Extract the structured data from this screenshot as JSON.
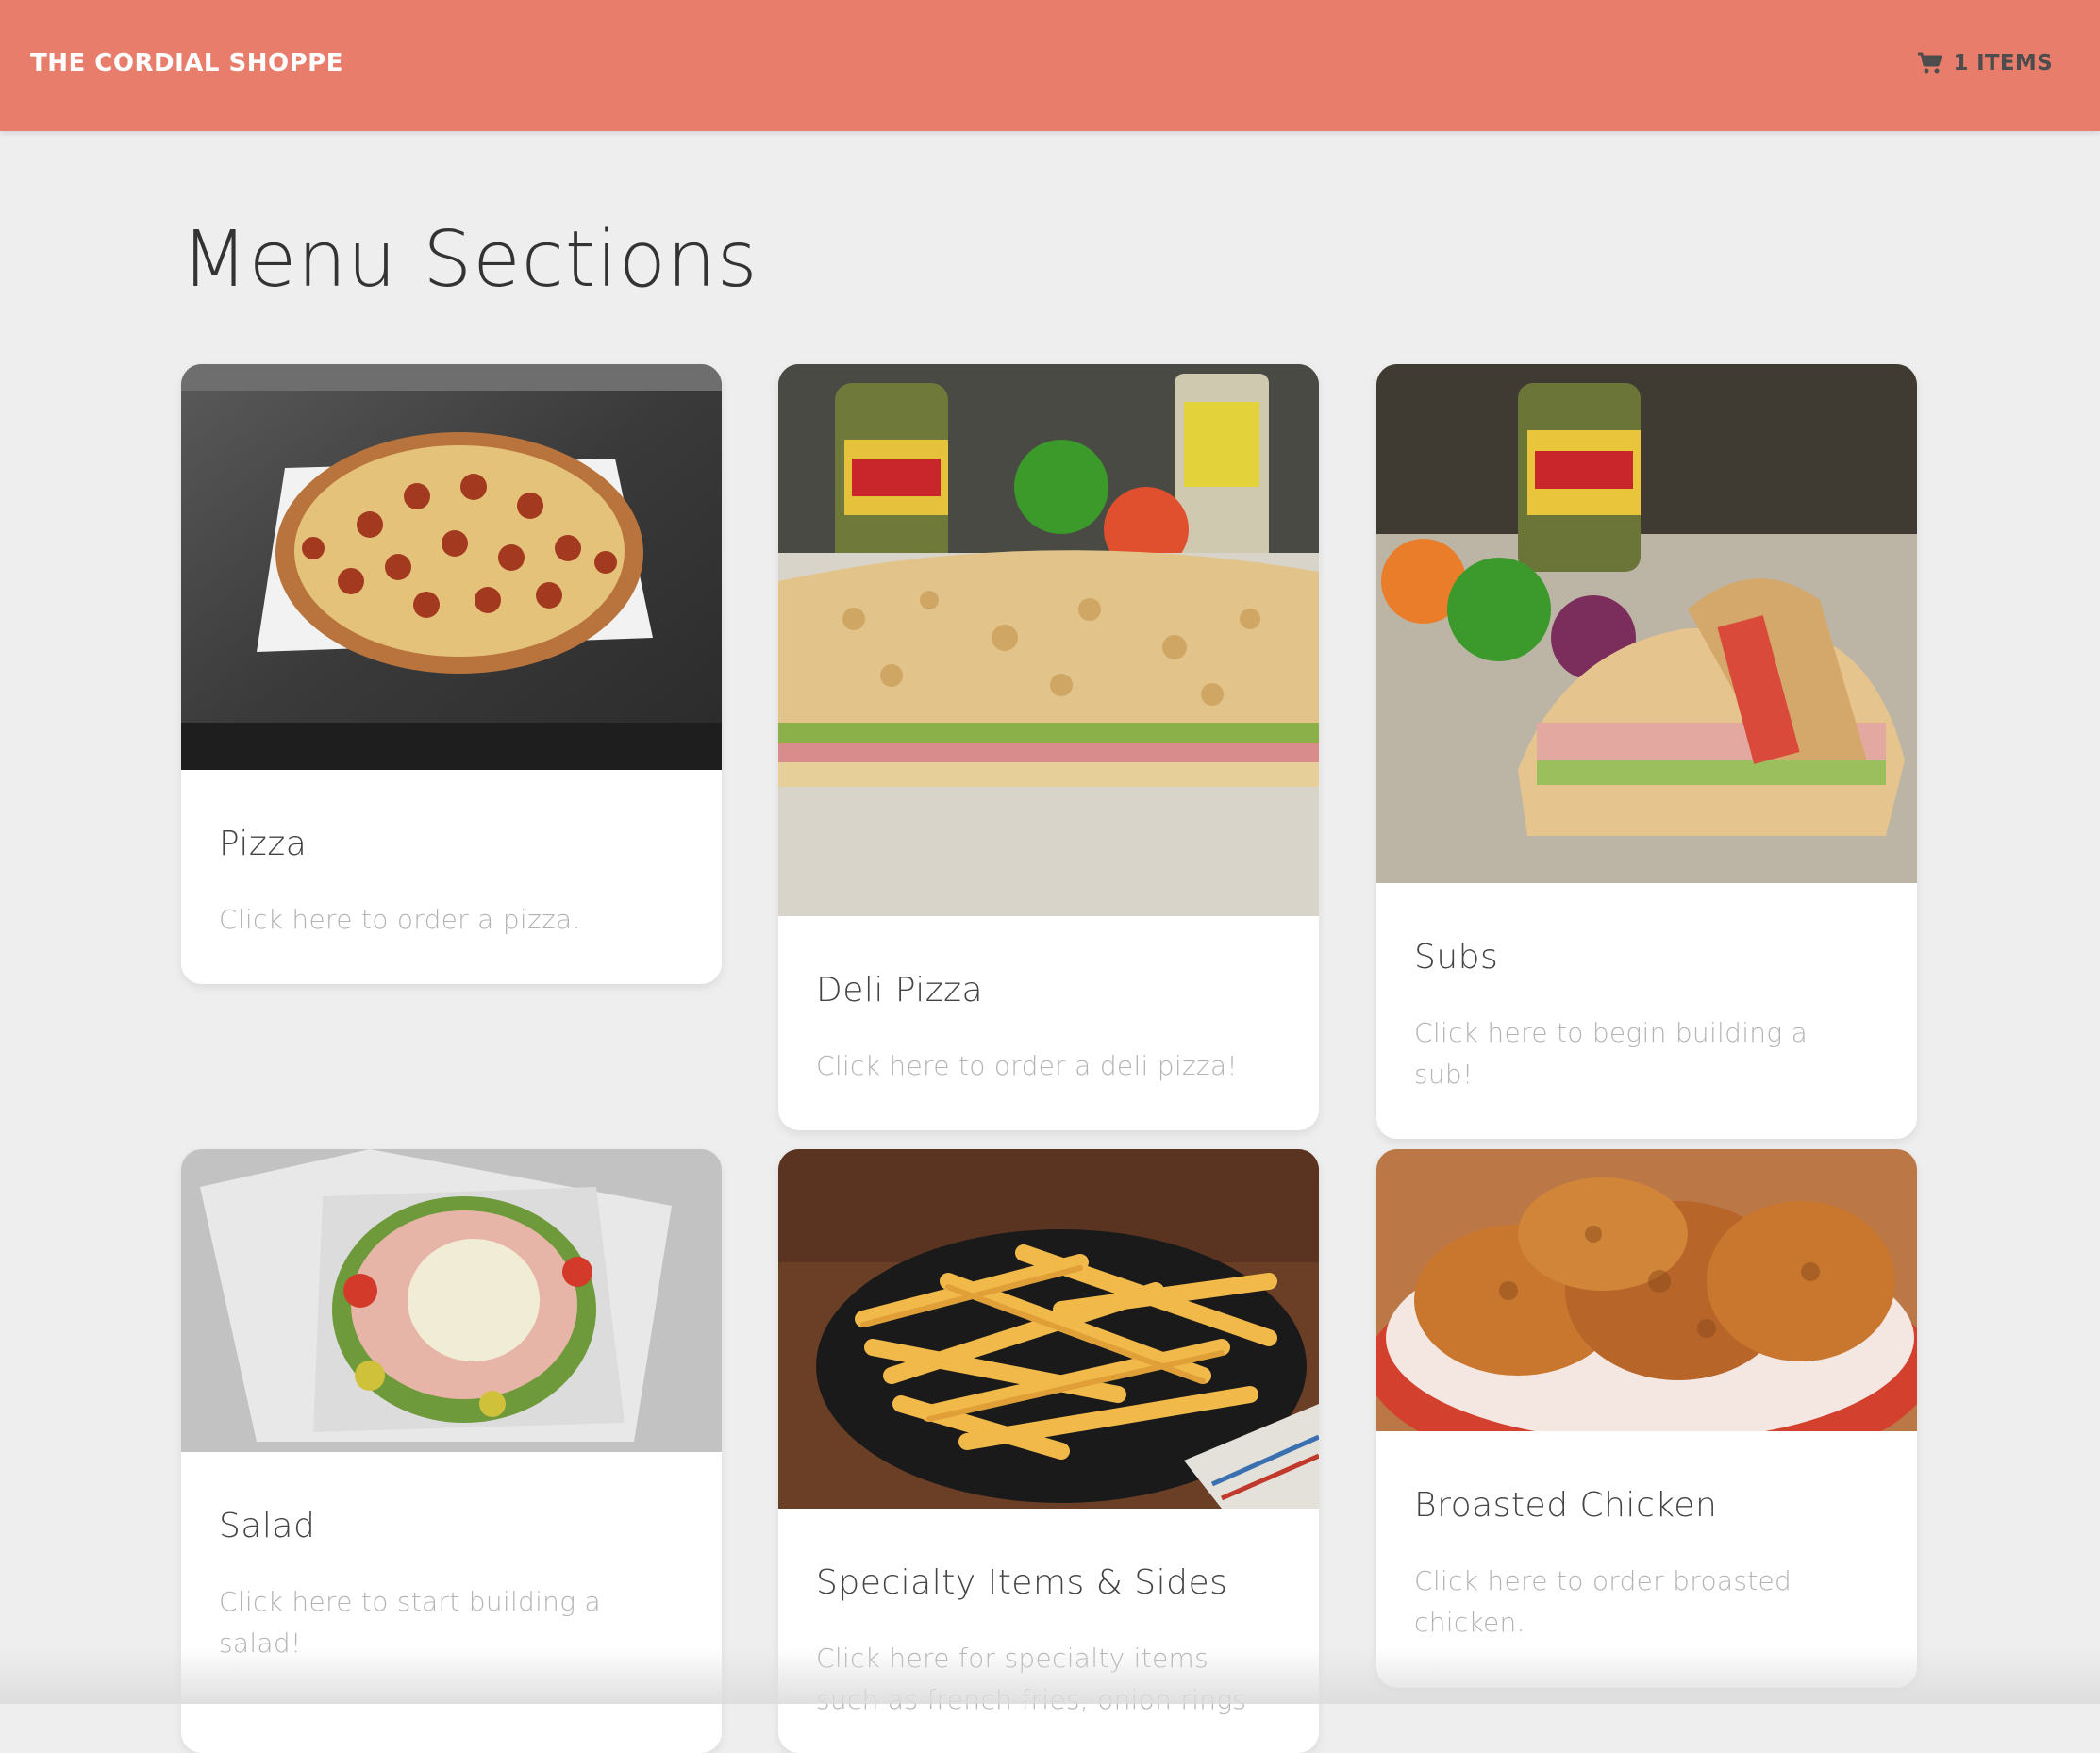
{
  "header": {
    "brand": "THE CORDIAL SHOPPE",
    "cart_label": "1 ITEMS",
    "cart_icon": "shopping-cart-icon"
  },
  "page": {
    "title": "Menu Sections"
  },
  "sections": [
    {
      "title": "Pizza",
      "description": "Click here to order a pizza.",
      "image": "pepperoni-pizza-photo"
    },
    {
      "title": "Deli Pizza",
      "description": "Click here to order a deli pizza!",
      "image": "deli-pizza-photo"
    },
    {
      "title": "Subs",
      "description": "Click here to begin building a sub!",
      "image": "sub-sandwich-photo"
    },
    {
      "title": "Salad",
      "description": "Click here to start building a salad!",
      "image": "chef-salad-photo"
    },
    {
      "title": "Specialty Items & Sides",
      "description": "Click here for specialty items such as french fries, onion rings",
      "image": "french-fries-photo"
    },
    {
      "title": "Broasted Chicken",
      "description": "Click here to order broasted chicken.",
      "image": "fried-chicken-photo"
    }
  ],
  "colors": {
    "header": "#e97d6b",
    "background": "#eeeeee",
    "card": "#ffffff"
  }
}
